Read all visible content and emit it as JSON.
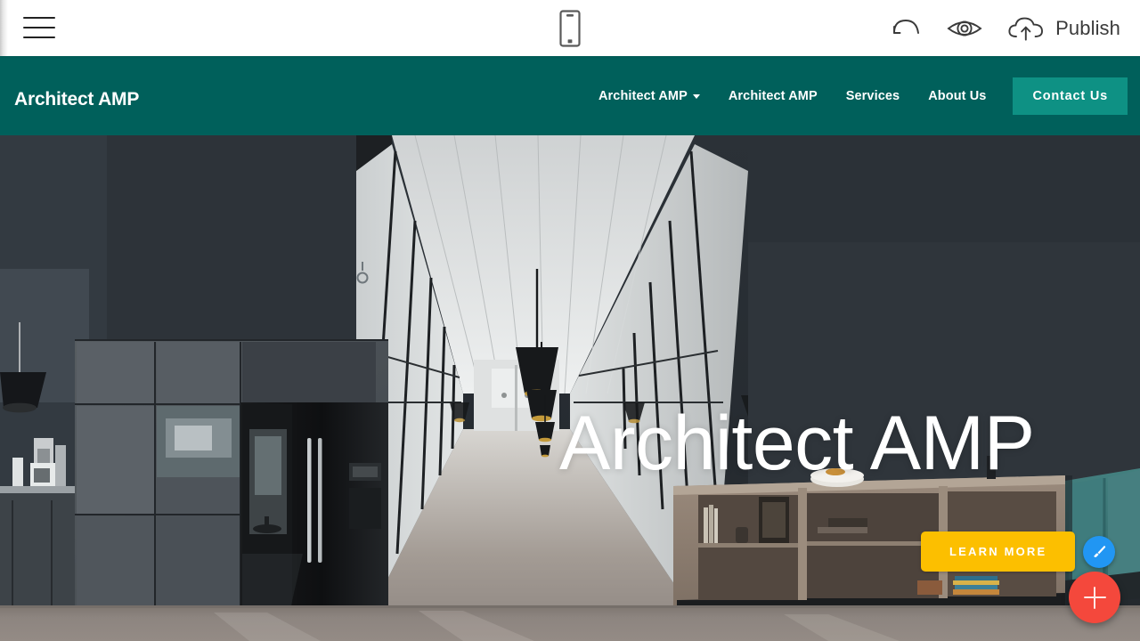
{
  "editor": {
    "menu_icon": "hamburger-menu-icon",
    "device_preview": {
      "icon": "mobile-device-icon",
      "label": "Mobile"
    },
    "undo": {
      "icon": "undo-arrow-icon",
      "label": "Undo"
    },
    "preview": {
      "icon": "eye-preview-icon",
      "label": "Preview"
    },
    "publish": {
      "icon": "cloud-upload-icon",
      "label": "Publish"
    }
  },
  "site": {
    "brand": "Architect AMP",
    "nav_items": [
      {
        "label": "Architect AMP",
        "has_dropdown": true
      },
      {
        "label": "Architect AMP",
        "has_dropdown": false
      },
      {
        "label": "Services",
        "has_dropdown": false
      },
      {
        "label": "About Us",
        "has_dropdown": false
      }
    ],
    "cta_label": "Contact Us",
    "hero": {
      "title": "Architect AMP",
      "button_label": "LEARN MORE",
      "background_description": "Modern dark office interior corridor with glass partitions, black pendant lamps, wooden shelving unit and teal sofa"
    }
  },
  "fabs": [
    {
      "name": "brush-fab",
      "icon": "paintbrush-icon",
      "color": "#2196f3"
    },
    {
      "name": "add-fab",
      "icon": "plus-icon",
      "color": "#f4483c"
    }
  ],
  "colors": {
    "nav_teal": "#00605b",
    "cta_teal": "#0e9184",
    "hero_button_yellow": "#fcbf00",
    "fab_blue": "#2196f3",
    "fab_red": "#f4483c",
    "toolbar_white": "#ffffff",
    "sofa_teal": "#3d7b7d",
    "floor_gray": "#8d8682"
  }
}
